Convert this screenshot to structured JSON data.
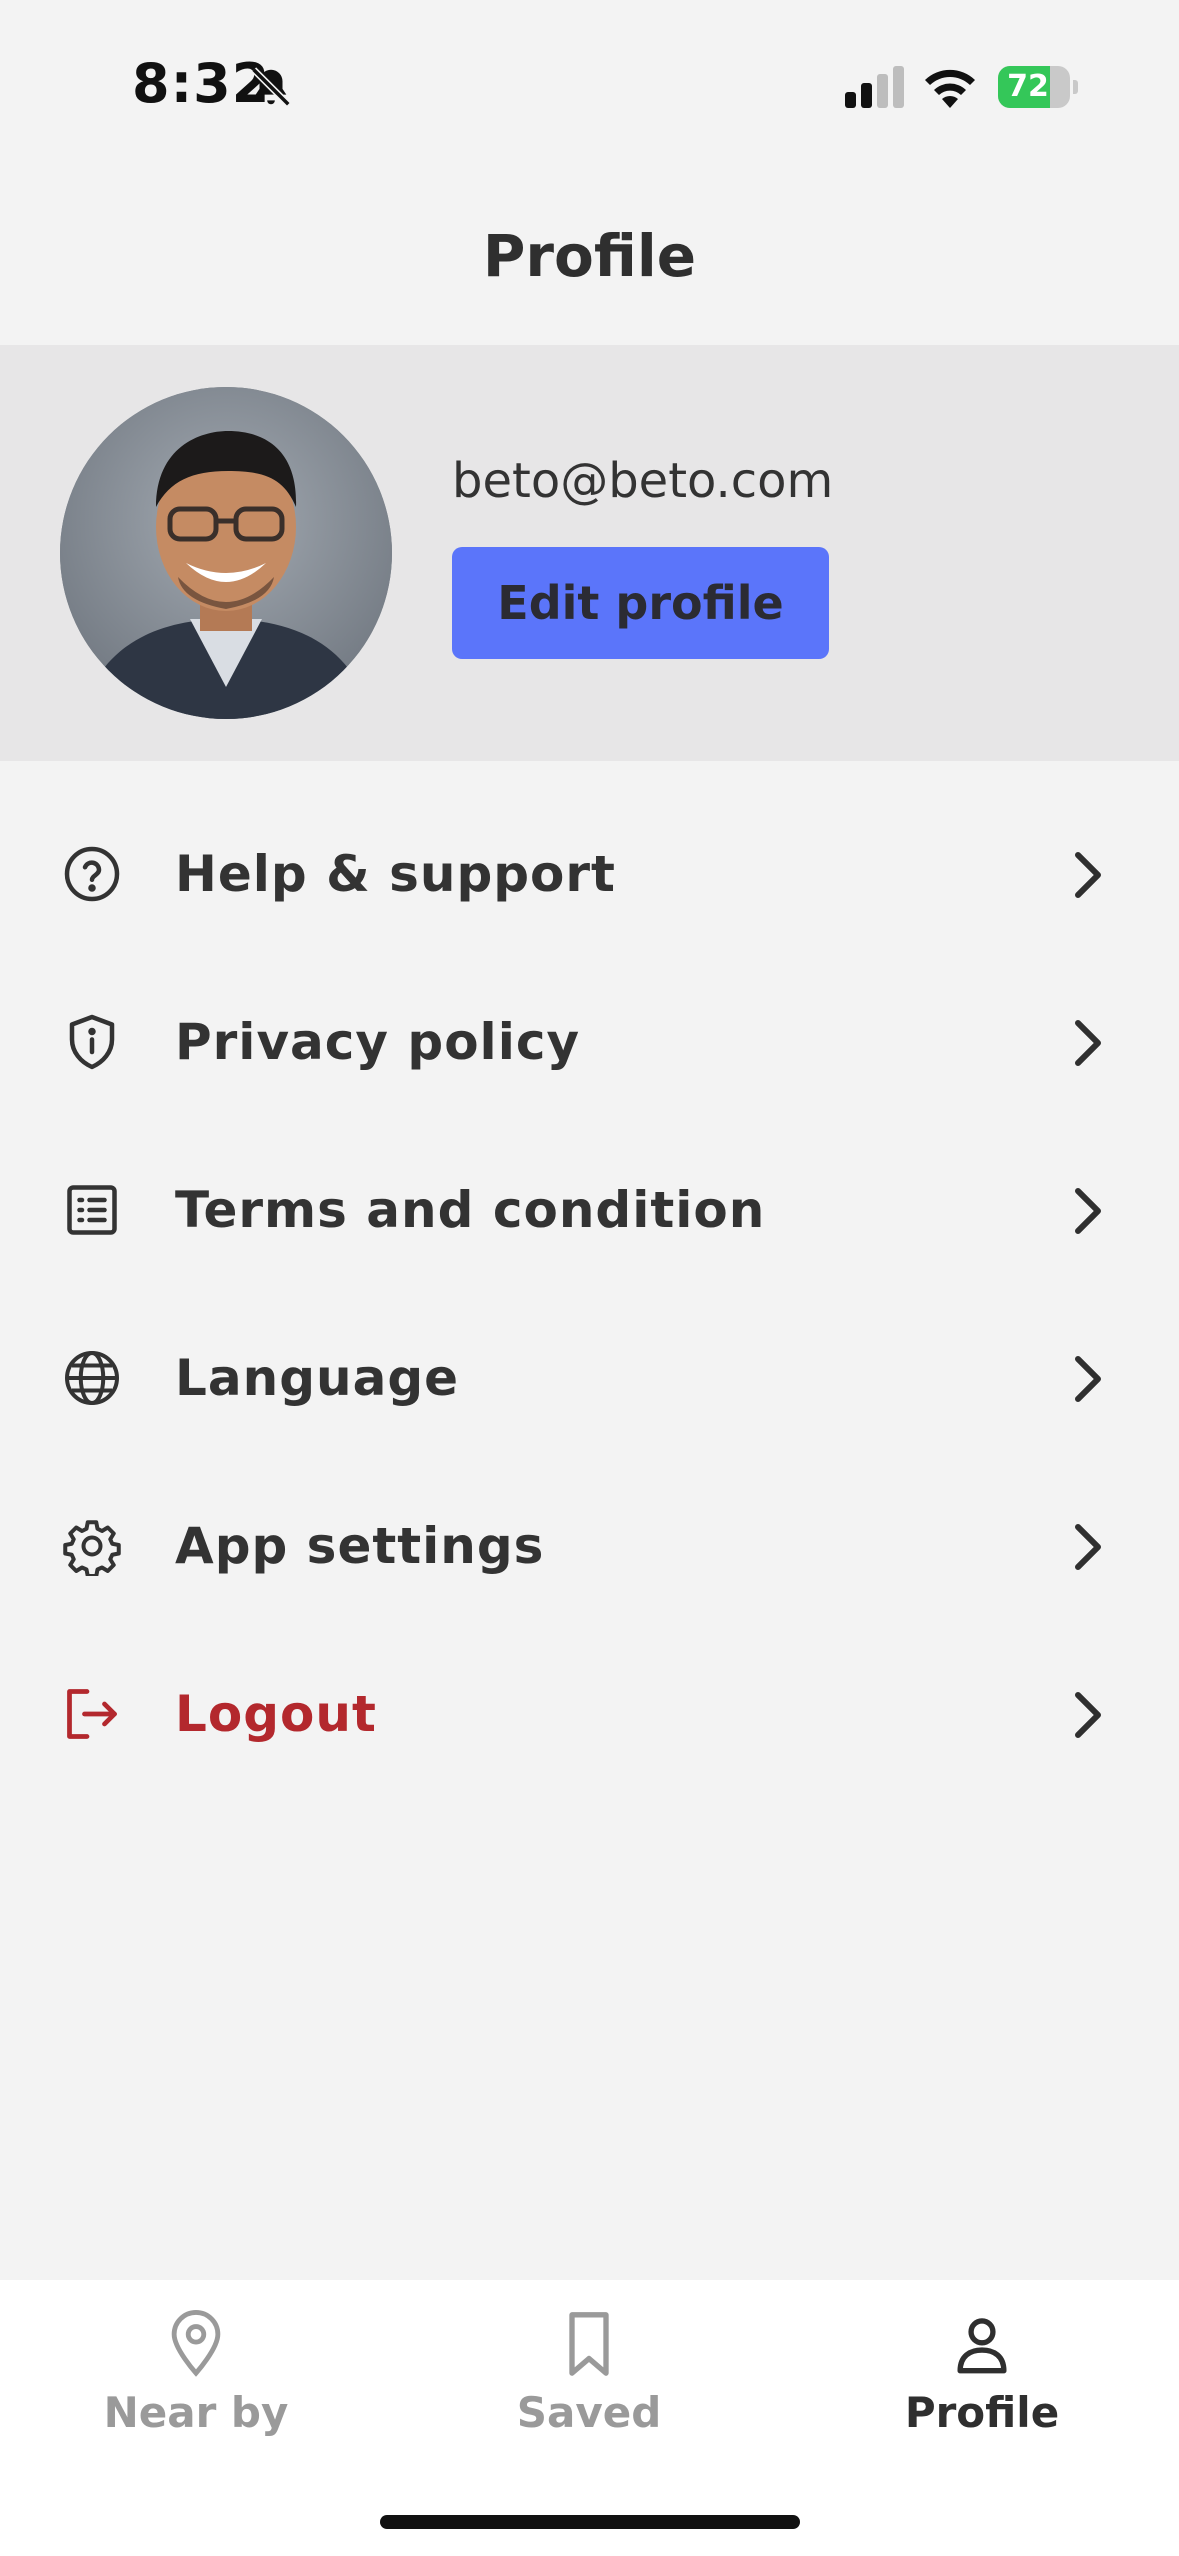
{
  "status_bar": {
    "time": "8:32",
    "battery_percent": "72",
    "battery_level": 0.72,
    "icons": [
      "bell-slash-icon",
      "cellular-signal-icon",
      "wifi-icon",
      "battery-charging-icon"
    ]
  },
  "header": {
    "title": "Profile"
  },
  "profile": {
    "email": "beto@beto.com",
    "edit_label": "Edit profile",
    "accent_color": "#5b75fa"
  },
  "menu": {
    "items": [
      {
        "label": "Help & support",
        "icon": "question-circle-icon"
      },
      {
        "label": "Privacy policy",
        "icon": "shield-info-icon"
      },
      {
        "label": "Terms and condition",
        "icon": "list-document-icon"
      },
      {
        "label": "Language",
        "icon": "globe-icon"
      },
      {
        "label": "App settings",
        "icon": "gear-icon"
      },
      {
        "label": "Logout",
        "icon": "logout-icon",
        "color": "#b3282d"
      }
    ]
  },
  "tabs": [
    {
      "label": "Near by",
      "icon": "map-pin-icon",
      "active": false
    },
    {
      "label": "Saved",
      "icon": "bookmark-icon",
      "active": false
    },
    {
      "label": "Profile",
      "icon": "person-icon",
      "active": true
    }
  ]
}
